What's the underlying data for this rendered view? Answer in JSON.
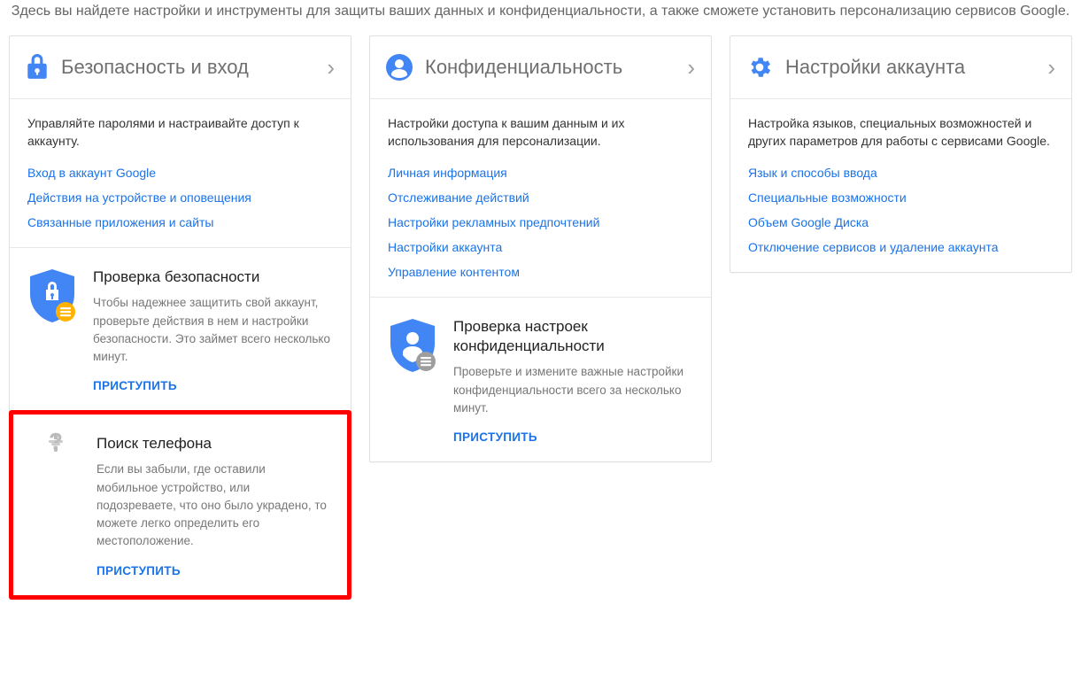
{
  "intro": "Здесь вы найдете настройки и инструменты для защиты ваших данных и конфиденциальности, а также сможете установить персонализацию сервисов Google.",
  "columns": {
    "security": {
      "title": "Безопасность и вход",
      "desc": "Управляйте паролями и настраивайте доступ к аккаунту.",
      "links": [
        "Вход в аккаунт Google",
        "Действия на устройстве и оповещения",
        "Связанные приложения и сайты"
      ],
      "checkup": {
        "title": "Проверка безопасности",
        "desc": "Чтобы надежнее защитить свой аккаунт, проверьте действия в нем и настройки безопасности. Это займет всего несколько минут.",
        "action": "ПРИСТУПИТЬ"
      },
      "findphone": {
        "title": "Поиск телефона",
        "desc": "Если вы забыли, где оставили мобильное устройство, или подозреваете, что оно было украдено, то можете легко определить его местоположение.",
        "action": "ПРИСТУПИТЬ"
      }
    },
    "privacy": {
      "title": "Конфиденциальность",
      "desc": "Настройки доступа к вашим данным и их использования для персонализации.",
      "links": [
        "Личная информация",
        "Отслеживание действий",
        "Настройки рекламных предпочтений",
        "Настройки аккаунта",
        "Управление контентом"
      ],
      "checkup": {
        "title": "Проверка настроек конфиденциальности",
        "desc": "Проверьте и измените важные настройки конфиденциальности всего за несколько минут.",
        "action": "ПРИСТУПИТЬ"
      }
    },
    "settings": {
      "title": "Настройки аккаунта",
      "desc": "Настройка языков, специальных возможностей и других параметров для работы с сервисами Google.",
      "links": [
        "Язык и способы ввода",
        "Специальные возможности",
        "Объем Google Диска",
        "Отключение сервисов и удаление аккаунта"
      ]
    }
  }
}
